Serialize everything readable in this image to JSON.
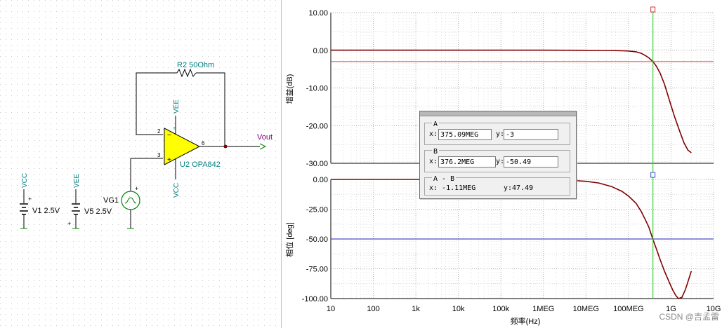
{
  "schematic": {
    "r2_label": "R2 50Ohm",
    "u2_label": "U2 OPA842",
    "vee_top": "VEE",
    "vcc_bottom": "VCC",
    "vout_label": "Vout",
    "vg1_label": "VG1",
    "v1_label": "V1 2.5V",
    "v5_label": "V5 2.5V",
    "vcc_label": "VCC",
    "vee_label": "VEE",
    "pin2": "2",
    "pin3": "3",
    "pin6": "6",
    "plus": "+",
    "minus": "−"
  },
  "plot": {
    "gain_ylabel": "增益(dB)",
    "phase_ylabel": "相位 [deg]",
    "xlabel": "频率(Hz)",
    "x_ticks": [
      "10",
      "100",
      "1k",
      "10k",
      "100k",
      "1MEG",
      "10MEG",
      "100MEG",
      "1G",
      "10G"
    ],
    "gain_ticks": [
      "10.00",
      "0.00",
      "-10.00",
      "-20.00",
      "-30.00"
    ],
    "phase_ticks": [
      "0.00",
      "-25.00",
      "-50.00",
      "-75.00",
      "-100.00"
    ],
    "watermark": "CSDN @吉孟雷",
    "colors": {
      "trace": "#800000",
      "gain_ref": "#e04040",
      "phase_ref": "#2020c0",
      "cursor": "#40d040"
    }
  },
  "cursor_panel": {
    "a_label": "A",
    "a_x_key": "x:",
    "a_x": "375.09MEG",
    "a_y_key": "y:",
    "a_y": "-3",
    "b_label": "B",
    "b_x_key": "x:",
    "b_x": "376.2MEG",
    "b_y_key": "y:",
    "b_y": "-50.49",
    "ab_label": "A - B",
    "ab_x": "x: -1.11MEG",
    "ab_y": "y:47.49"
  },
  "chart_data": {
    "type": "line",
    "x_scale": "log",
    "xlim": [
      10,
      10000000000
    ],
    "panels": [
      {
        "ylim": [
          -30,
          10
        ],
        "x": [
          10,
          100,
          1000,
          10000,
          100000,
          1000000,
          10000000,
          30000000,
          60000000,
          100000000,
          150000000,
          200000000,
          250000000,
          300000000,
          375090000,
          450000000,
          550000000,
          700000000,
          900000000,
          1200000000,
          1600000000,
          2000000000,
          2500000000,
          3000000000
        ],
        "y": [
          0.02,
          0.02,
          0.02,
          0.02,
          0.02,
          0.02,
          0.0,
          -0.05,
          -0.1,
          -0.2,
          -0.4,
          -0.8,
          -1.4,
          -2.0,
          -3.0,
          -4.2,
          -6.0,
          -9.0,
          -13.0,
          -17.5,
          -21.5,
          -24.5,
          -26.5,
          -27.2
        ],
        "ref_y": -3
      },
      {
        "ylim": [
          -100,
          0
        ],
        "x": [
          10,
          100,
          1000,
          10000,
          100000,
          1000000,
          2000000,
          5000000,
          10000000,
          20000000,
          40000000,
          70000000,
          100000000,
          150000000,
          200000000,
          250000000,
          300000000,
          376200000,
          450000000,
          550000000,
          700000000,
          900000000,
          1100000000,
          1300000000,
          1500000000,
          1800000000,
          2200000000,
          2700000000,
          3000000000
        ],
        "y": [
          0,
          0,
          0,
          0,
          0,
          -0.2,
          -0.4,
          -0.9,
          -1.6,
          -3.0,
          -6.0,
          -10.0,
          -14.0,
          -20.0,
          -27.0,
          -34.0,
          -40.0,
          -50.49,
          -58.0,
          -67.0,
          -77.0,
          -86.0,
          -93.0,
          -97.5,
          -100.0,
          -99.0,
          -92.0,
          -82.0,
          -77.0
        ],
        "ref_y": -50
      }
    ],
    "cursor_x": 375090000
  }
}
